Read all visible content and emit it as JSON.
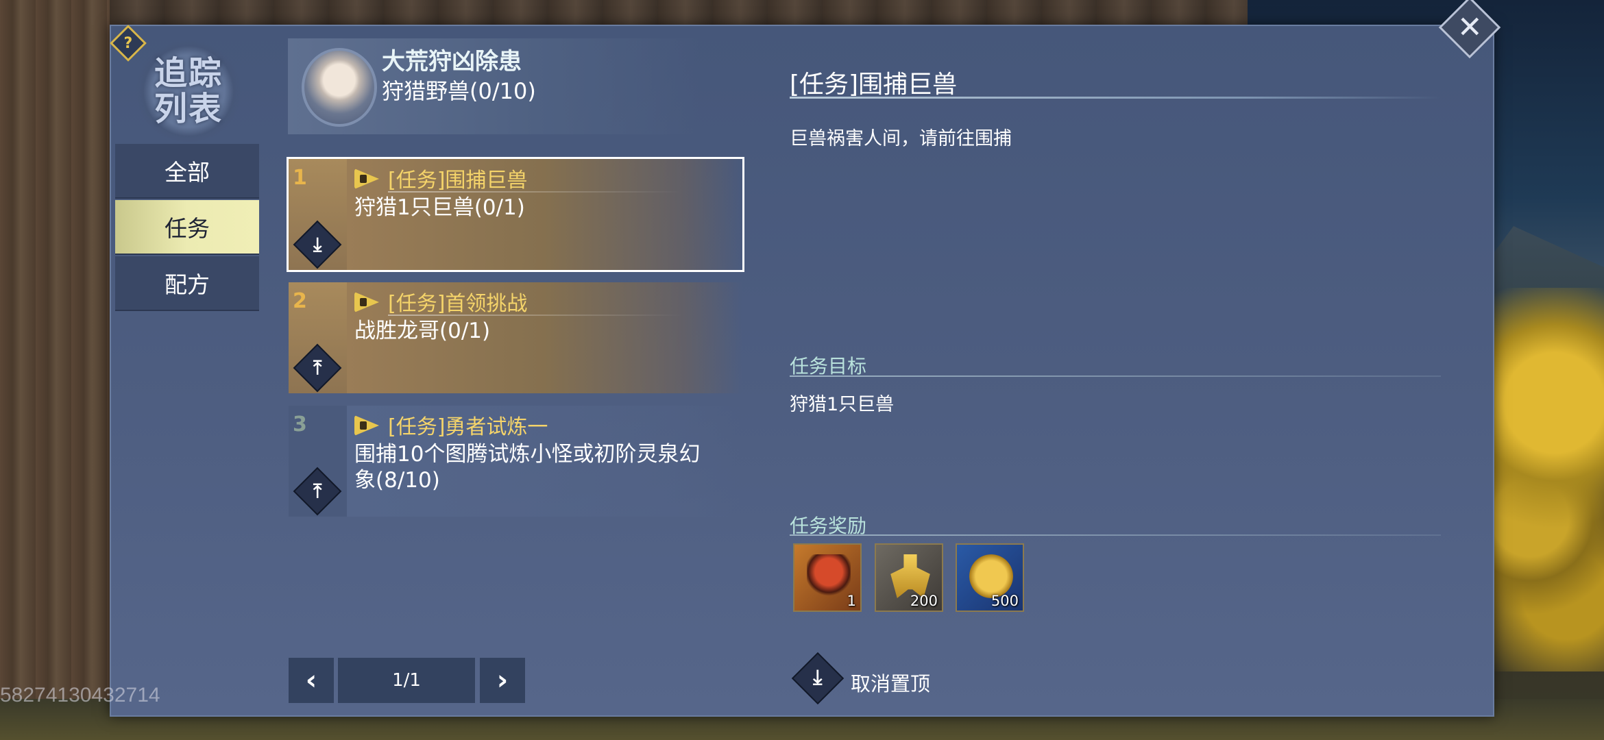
{
  "help_icon": "?",
  "close_icon": "✕",
  "nav": {
    "emblem_line1": "追踪",
    "emblem_line2": "列表",
    "items": [
      {
        "label": "全部"
      },
      {
        "label": "任务"
      },
      {
        "label": "配方"
      }
    ],
    "active_index": 1
  },
  "chapter": {
    "title": "大荒狩凶除患",
    "subtitle": "狩猎野兽(0/10)"
  },
  "quests": [
    {
      "num": "1",
      "title": "[任务]围捕巨兽",
      "desc": "狩猎1只巨兽(0/1)",
      "pin_icon": "⤓"
    },
    {
      "num": "2",
      "title": "[任务]首领挑战",
      "desc": "战胜龙哥(0/1)",
      "pin_icon": "⤒"
    },
    {
      "num": "3",
      "title": "[任务]勇者试炼一",
      "desc": "围捕10个图腾试炼小怪或初阶灵泉幻象(8/10)",
      "pin_icon": "⤒"
    }
  ],
  "pagination": {
    "prev_icon": "‹",
    "next_icon": "›",
    "page": "1/1"
  },
  "detail": {
    "title": "[任务]围捕巨兽",
    "description": "巨兽祸害人间，请前往围捕",
    "objective_header": "任务目标",
    "objective": "狩猎1只巨兽",
    "reward_header": "任务奖励",
    "rewards": [
      {
        "icon": "chest-reward-icon",
        "count": "1"
      },
      {
        "icon": "gold-armor-icon",
        "count": "200"
      },
      {
        "icon": "gold-coin-icon",
        "count": "500"
      }
    ],
    "unpin_icon": "⤓",
    "unpin_label": "取消置顶"
  },
  "watermark": "58274130432714",
  "colors": {
    "panel": "#4d5d80",
    "quest_title": "#f5d46a",
    "section_head": "#b9e2dc",
    "active_tab": "#ecebb2"
  }
}
